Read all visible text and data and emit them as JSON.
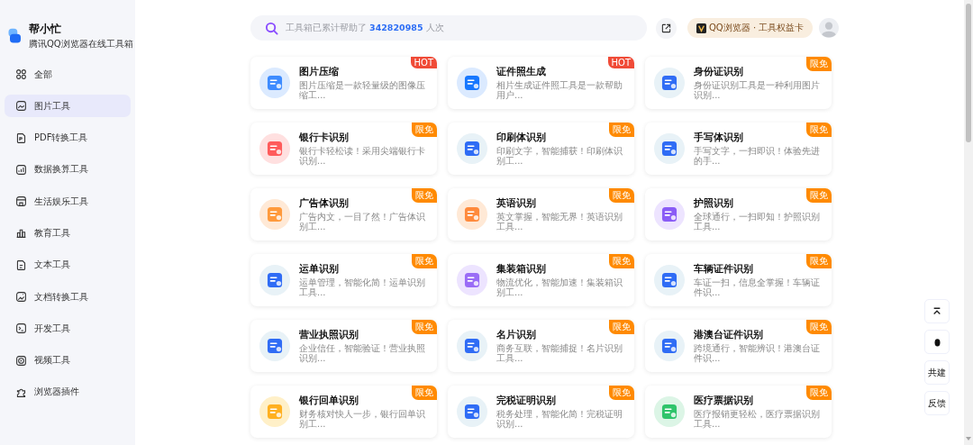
{
  "brand": {
    "name": "帮小忙",
    "tagline": "腾讯QQ浏览器在线工具箱"
  },
  "sidebar": {
    "items": [
      {
        "label": "全部",
        "selected": false
      },
      {
        "label": "图片工具",
        "selected": true
      },
      {
        "label": "PDF转换工具",
        "selected": false
      },
      {
        "label": "数据换算工具",
        "selected": false
      },
      {
        "label": "生活娱乐工具",
        "selected": false
      },
      {
        "label": "教育工具",
        "selected": false
      },
      {
        "label": "文本工具",
        "selected": false
      },
      {
        "label": "文档转换工具",
        "selected": false
      },
      {
        "label": "开发工具",
        "selected": false
      },
      {
        "label": "视频工具",
        "selected": false
      },
      {
        "label": "浏览器插件",
        "selected": false
      }
    ]
  },
  "search": {
    "prefix": "工具箱已累计帮助了",
    "count": "342820985",
    "suffix": "人次"
  },
  "header": {
    "promo": "QQ浏览器 · 工具权益卡"
  },
  "tools": [
    {
      "title": "图片压缩",
      "desc": "图片压缩是一款轻量级的图像压缩工...",
      "badge": "HOT",
      "hot": true
    },
    {
      "title": "证件照生成",
      "desc": "相片生成证件照工具是一款帮助用户...",
      "badge": "HOT",
      "hot": true
    },
    {
      "title": "身份证识别",
      "desc": "身份证识别工具是一种利用图片识别...",
      "badge": "限免",
      "hot": false
    },
    {
      "title": "银行卡识别",
      "desc": "银行卡轻松读！采用尖端银行卡识别...",
      "badge": "限免",
      "hot": false
    },
    {
      "title": "印刷体识别",
      "desc": "印刷文字，智能捕获！印刷体识别工...",
      "badge": "限免",
      "hot": false
    },
    {
      "title": "手写体识别",
      "desc": "手写文字，一扫即识！体验先进的手...",
      "badge": "限免",
      "hot": false
    },
    {
      "title": "广告体识别",
      "desc": "广告内文，一目了然！广告体识别工...",
      "badge": "限免",
      "hot": false
    },
    {
      "title": "英语识别",
      "desc": "英文掌握，智能无界！英语识别工具...",
      "badge": "限免",
      "hot": false
    },
    {
      "title": "护照识别",
      "desc": "全球通行，一扫即知！护照识别工具...",
      "badge": "限免",
      "hot": false
    },
    {
      "title": "运单识别",
      "desc": "运单管理，智能化简！运单识别工具...",
      "badge": "限免",
      "hot": false
    },
    {
      "title": "集装箱识别",
      "desc": "物流优化，智能加速！集装箱识别工...",
      "badge": "限免",
      "hot": false
    },
    {
      "title": "车辆证件识别",
      "desc": "车证一扫，信息全掌握！车辆证件识...",
      "badge": "限免",
      "hot": false
    },
    {
      "title": "营业执照识别",
      "desc": "企业信任，智能验证！营业执照识别...",
      "badge": "限免",
      "hot": false
    },
    {
      "title": "名片识别",
      "desc": "商务互联，智能捕捉！名片识别工具...",
      "badge": "限免",
      "hot": false
    },
    {
      "title": "港澳台证件识别",
      "desc": "跨境通行，智能辨识！港澳台证件识...",
      "badge": "限免",
      "hot": false
    },
    {
      "title": "银行回单识别",
      "desc": "财务核对快人一步，银行回单识别工...",
      "badge": "限免",
      "hot": false
    },
    {
      "title": "完税证明识别",
      "desc": "税务处理，智能化简！完税证明识别...",
      "badge": "限免",
      "hot": false
    },
    {
      "title": "医疗票据识别",
      "desc": "医疗报销更轻松，医疗票据识别工具...",
      "badge": "限免",
      "hot": false
    }
  ],
  "float_buttons": [
    {
      "kind": "top"
    },
    {
      "kind": "qq"
    },
    {
      "kind": "text",
      "label": "共建"
    },
    {
      "kind": "text",
      "label": "反馈"
    }
  ]
}
